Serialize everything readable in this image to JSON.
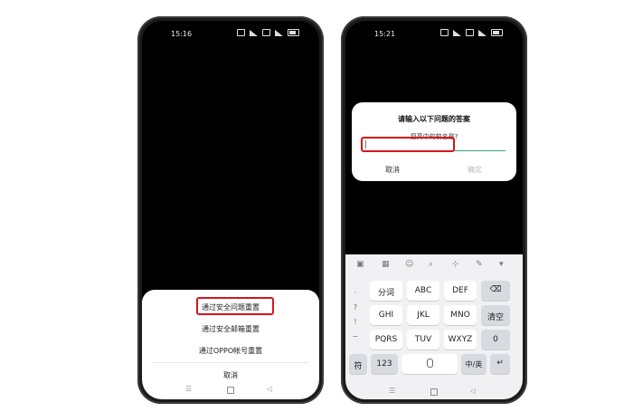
{
  "left_phone": {
    "time": "15:16",
    "sheet_options": [
      {
        "label": "通过安全问题重置"
      },
      {
        "label": "通过安全邮箱重置"
      },
      {
        "label": "通过OPPO帐号重置"
      },
      {
        "label": "取消"
      }
    ],
    "nav": {
      "menu": "☰",
      "home": "",
      "back": "◁"
    }
  },
  "right_phone": {
    "time": "15:21",
    "dialog": {
      "title": "请输入以下问题的答案",
      "question": "您高中的校名是?",
      "input_value": "",
      "cancel_label": "取消",
      "confirm_label": "确定"
    },
    "keyboard": {
      "toolbar": [
        "▣",
        "▦",
        "☺",
        "⌕",
        "⊹",
        "✎",
        "▾"
      ],
      "side_column": [
        "·",
        "?",
        "!",
        "~"
      ],
      "rows": [
        [
          "分词",
          "ABC",
          "DEF",
          "⌫"
        ],
        [
          "GHI",
          "JKL",
          "MNO",
          "清空"
        ],
        [
          "PQRS",
          "TUV",
          "WXYZ",
          "0"
        ]
      ],
      "bottom_row": {
        "symbols": "符",
        "numbers": "123",
        "space": "",
        "lang": "中/英",
        "enter": "↵"
      }
    },
    "nav": {
      "menu": "☰",
      "home": "",
      "back": "◁"
    }
  },
  "colors": {
    "highlight": "#d9141c",
    "input_line": "#3aa080"
  }
}
